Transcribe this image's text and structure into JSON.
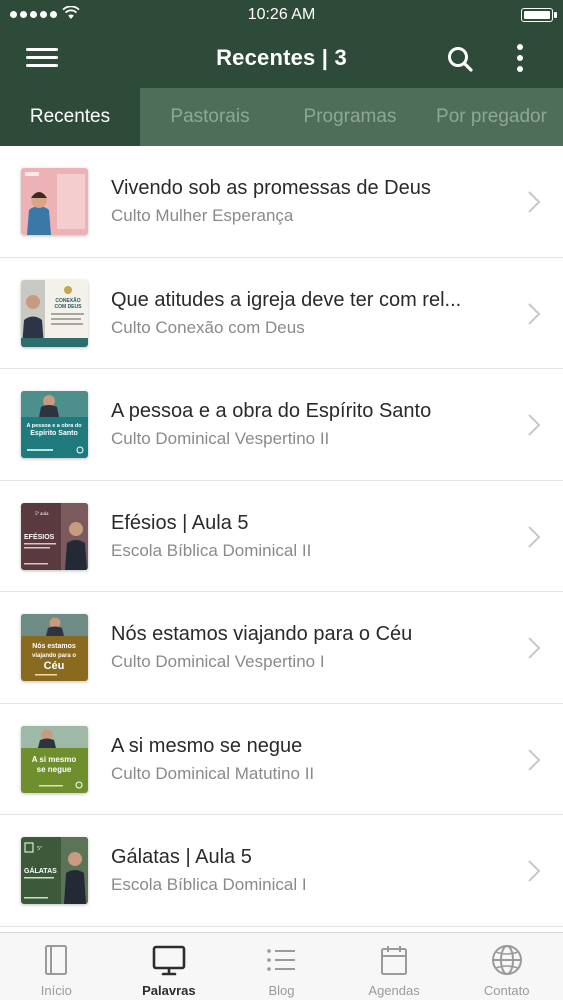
{
  "status_bar": {
    "time": "10:26 AM"
  },
  "header": {
    "title": "Recentes | 3"
  },
  "tabs": [
    {
      "label": "Recentes",
      "active": true
    },
    {
      "label": "Pastorais",
      "active": false
    },
    {
      "label": "Programas",
      "active": false
    },
    {
      "label": "Por pregador",
      "active": false
    }
  ],
  "items": [
    {
      "title": "Vivendo sob as promessas de Deus",
      "subtitle": "Culto Mulher Esperança",
      "thumb_color": "#e9a9ad"
    },
    {
      "title": "Que atitudes a igreja deve ter com rel...",
      "subtitle": "Culto Conexão com Deus",
      "thumb_color": "#f3f1ea",
      "thumb_text": [
        "CONEXÃO",
        "COM DEUS"
      ]
    },
    {
      "title": "A pessoa e a obra do Espírito Santo",
      "subtitle": "Culto Dominical Vespertino II",
      "thumb_color": "#1f7a7d",
      "thumb_text": [
        "A pessoa e a obra do",
        "Espírito Santo"
      ]
    },
    {
      "title": "Efésios | Aula 5",
      "subtitle": "Escola Bíblica Dominical II",
      "thumb_color": "#5a3a3e",
      "thumb_text": [
        "5ª aula",
        "EFÉSIOS"
      ]
    },
    {
      "title": "Nós estamos viajando para o Céu",
      "subtitle": "Culto Dominical Vespertino I",
      "thumb_color": "#8a6a1e",
      "thumb_text": [
        "Nós estamos",
        "viajando para o",
        "Céu"
      ]
    },
    {
      "title": "A si mesmo se negue",
      "subtitle": "Culto Dominical Matutino II",
      "thumb_color": "#6f8f2e",
      "thumb_text": [
        "A si mesmo",
        "se negue"
      ]
    },
    {
      "title": "Gálatas | Aula 5",
      "subtitle": "Escola Bíblica Dominical I",
      "thumb_color": "#3c5a3a",
      "thumb_text": [
        "5ª",
        "GÁLATAS"
      ]
    }
  ],
  "tabbar": [
    {
      "label": "Início",
      "icon": "book-icon",
      "active": false
    },
    {
      "label": "Palavras",
      "icon": "tv-icon",
      "active": true
    },
    {
      "label": "Blog",
      "icon": "list-icon",
      "active": false
    },
    {
      "label": "Agendas",
      "icon": "calendar-icon",
      "active": false
    },
    {
      "label": "Contato",
      "icon": "globe-icon",
      "active": false
    }
  ],
  "colors": {
    "header_bg": "#2e4a38",
    "tabstrip_bg": "#4f6e59",
    "tab_inactive_text": "#8ea796"
  }
}
